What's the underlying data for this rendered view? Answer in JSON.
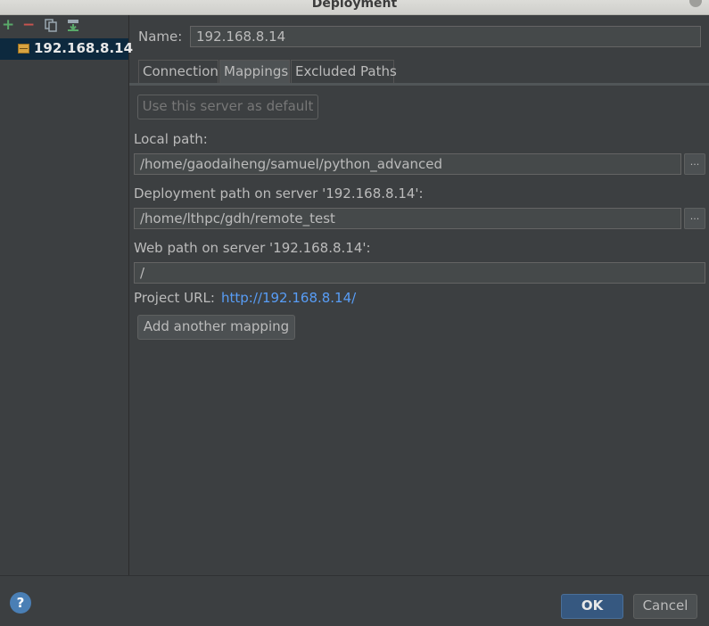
{
  "window": {
    "title": "Deployment"
  },
  "sidebar": {
    "toolbar": {
      "add_glyph": "+",
      "remove_glyph": "−",
      "icons": [
        "plus-icon",
        "minus-icon",
        "copy-icon",
        "import-icon"
      ]
    },
    "servers": [
      {
        "label": "192.168.8.14",
        "icon": "sftp-server-icon",
        "selected": true
      }
    ]
  },
  "form": {
    "name_label": "Name:",
    "name_value": "192.168.8.14",
    "tabs": [
      {
        "label": "Connection",
        "active": false
      },
      {
        "label": "Mappings",
        "active": true
      },
      {
        "label": "Excluded Paths",
        "active": false
      }
    ],
    "default_button": "Use this server as default",
    "local_path_label": "Local path:",
    "local_path_value": "/home/gaodaiheng/samuel/python_advanced",
    "deploy_path_label": "Deployment path on server '192.168.8.14':",
    "deploy_path_value": "/home/lthpc/gdh/remote_test",
    "web_path_label": "Web path on server '192.168.8.14':",
    "web_path_value": "/",
    "browse_label": "...",
    "project_url_label": "Project URL:",
    "project_url_value": "http://192.168.8.14/",
    "add_mapping_button": "Add another mapping"
  },
  "footer": {
    "help_glyph": "?",
    "ok_label": "OK",
    "cancel_label": "Cancel"
  },
  "colors": {
    "background": "#3c3f41",
    "selection": "#0d293e",
    "link": "#589df6",
    "ok_button": "#365880",
    "add_icon": "#59a869",
    "remove_icon": "#c75450"
  }
}
